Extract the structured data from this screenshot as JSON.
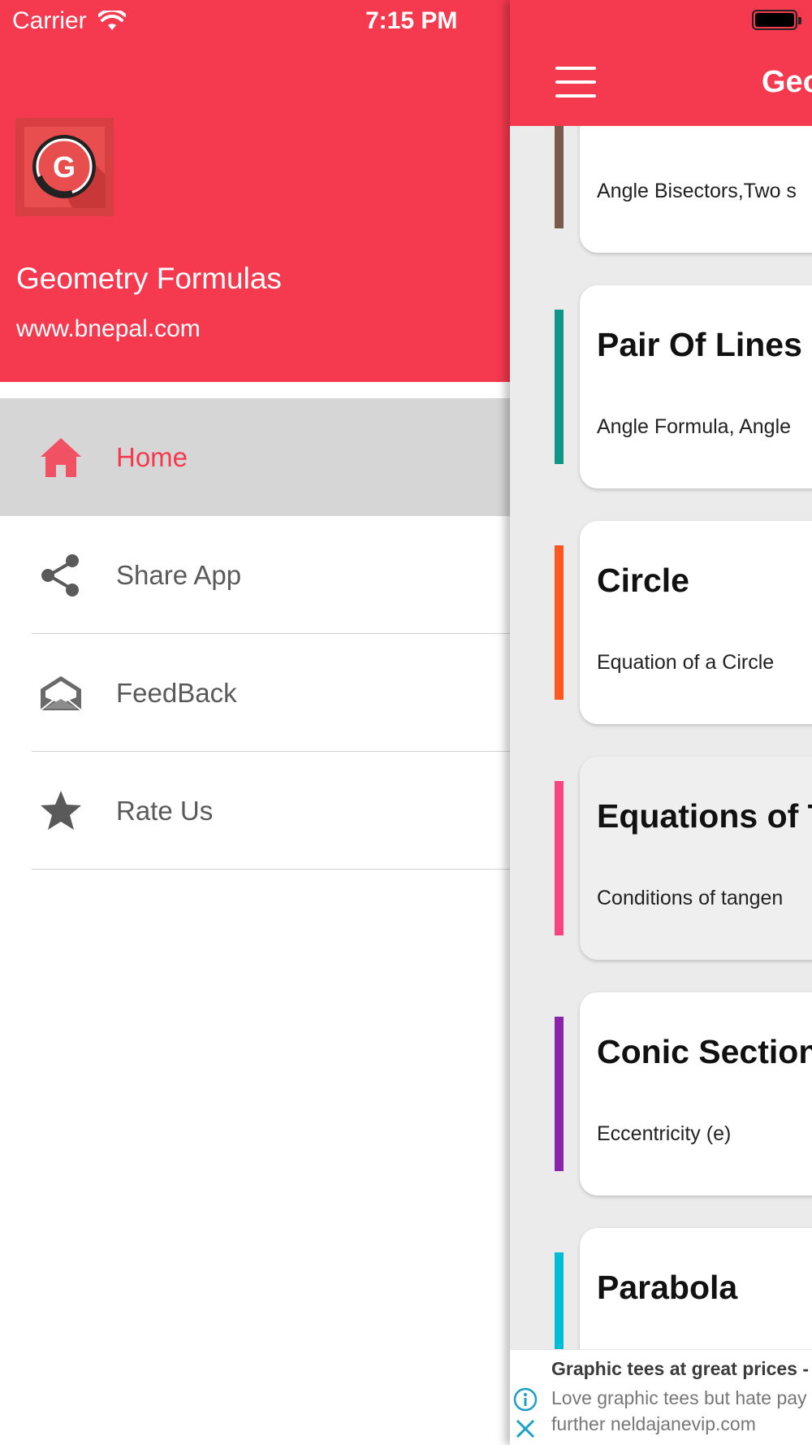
{
  "status_bar": {
    "carrier": "Carrier",
    "time": "7:15 PM"
  },
  "drawer": {
    "logo_letter": "G",
    "title": "Geometry Formulas",
    "subtitle": "www.bnepal.com",
    "menu": [
      {
        "label": "Home",
        "icon": "home-icon",
        "active": true
      },
      {
        "label": "Share App",
        "icon": "share-icon",
        "active": false
      },
      {
        "label": "FeedBack",
        "icon": "envelope-open-icon",
        "active": false
      },
      {
        "label": "Rate Us",
        "icon": "star-icon",
        "active": false
      }
    ]
  },
  "main": {
    "nav_title": "Geo",
    "cards": [
      {
        "title": "",
        "subtitle": "Angle Bisectors,Two s",
        "accent": "#7b5a4e"
      },
      {
        "title": "Pair Of Lines",
        "subtitle": "Angle Formula, Angle",
        "accent": "#0f9688"
      },
      {
        "title": "Circle",
        "subtitle": "Equation of a Circle",
        "accent": "#ff5722"
      },
      {
        "title": "Equations of T",
        "subtitle": "Conditions of tangen",
        "accent": "#f94582"
      },
      {
        "title": "Conic Section",
        "subtitle": "Eccentricity (e)",
        "accent": "#8a24a8"
      },
      {
        "title": "Parabola",
        "subtitle": "",
        "accent": "#00bcd4"
      }
    ]
  },
  "ad": {
    "title": "Graphic tees at great prices - I",
    "body_line1": "Love graphic tees but hate pay",
    "body_line2": "further neldajanevip.com"
  },
  "colors": {
    "brand": "#f5394f",
    "drawer_active_bg": "#d6d6d6",
    "icon_gray": "#5a5a5a"
  }
}
